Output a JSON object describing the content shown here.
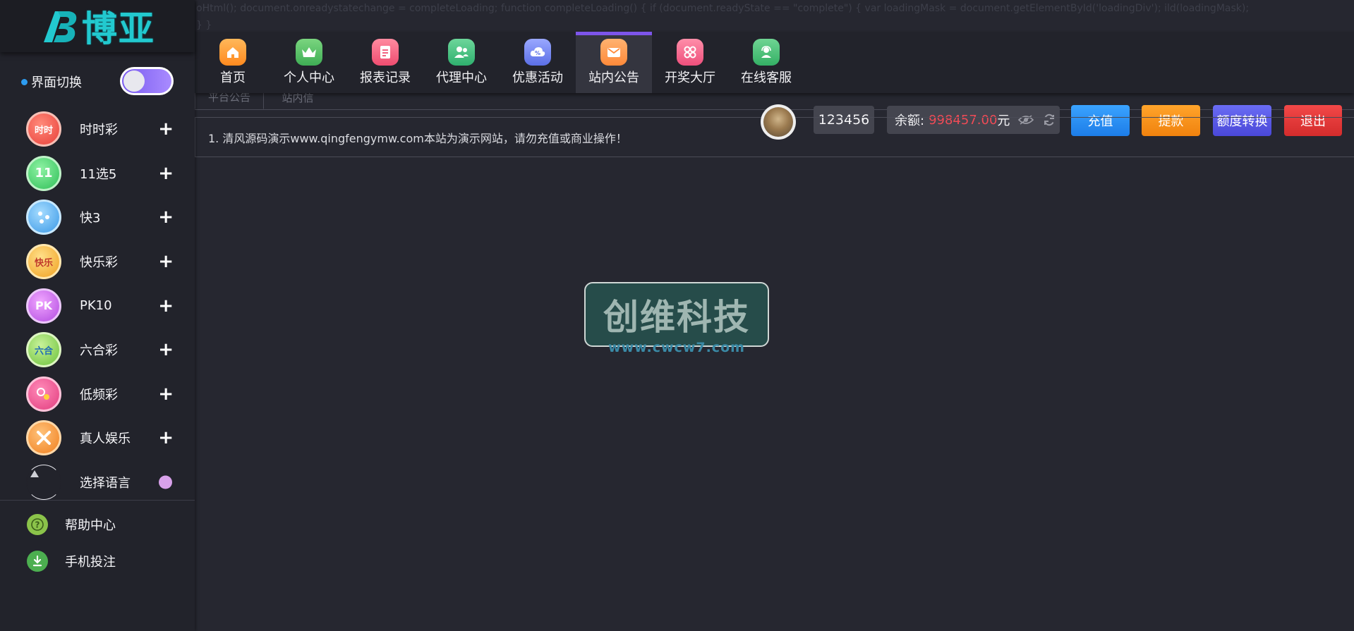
{
  "code_text": "oHtml(); document.onreadystatechange = completeLoading; function completeLoading() { if (document.readyState == \"complete\") { var loadingMask = document.getElementById('loadingDiv'); ild(loadingMask); } }",
  "logo": {
    "text": "博亚"
  },
  "theme_switch": {
    "label": "界面切换"
  },
  "sidebar": {
    "items": [
      {
        "label": "时时彩",
        "icon": "shishicai-icon",
        "badge": "时时"
      },
      {
        "label": "11选5",
        "icon": "11x5-icon",
        "badge": "11"
      },
      {
        "label": "快3",
        "icon": "dice-icon",
        "badge": ""
      },
      {
        "label": "快乐彩",
        "icon": "kuailecai-icon",
        "badge": "快乐"
      },
      {
        "label": "PK10",
        "icon": "pk10-icon",
        "badge": "PK"
      },
      {
        "label": "六合彩",
        "icon": "liuhecai-icon",
        "badge": "六合"
      },
      {
        "label": "低频彩",
        "icon": "lowfreq-icon",
        "badge": ""
      },
      {
        "label": "真人娱乐",
        "icon": "live-casino-icon",
        "badge": ""
      },
      {
        "label": "选择语言",
        "icon": "language-icon",
        "badge": ""
      }
    ],
    "bottom": [
      {
        "label": "帮助中心",
        "icon": "help-icon"
      },
      {
        "label": "手机投注",
        "icon": "download-icon"
      }
    ]
  },
  "nav": {
    "items": [
      {
        "label": "首页",
        "icon": "home-icon",
        "color": "#ffa33a"
      },
      {
        "label": "个人中心",
        "icon": "crown-icon",
        "color": "#5ec46a"
      },
      {
        "label": "报表记录",
        "icon": "report-icon",
        "color": "#f56b87"
      },
      {
        "label": "代理中心",
        "icon": "agent-icon",
        "color": "#4cc285"
      },
      {
        "label": "优惠活动",
        "icon": "promo-icon",
        "color": "#7a8cf0"
      },
      {
        "label": "站内公告",
        "icon": "mail-icon",
        "color": "#ff9a4a"
      },
      {
        "label": "开奖大厅",
        "icon": "lottery-hall-icon",
        "color": "#f06a8e"
      },
      {
        "label": "在线客服",
        "icon": "support-icon",
        "color": "#4fc27b"
      }
    ],
    "active_index": 5
  },
  "subtabs": {
    "first": "平台公告",
    "second": "站内信"
  },
  "user": {
    "id": "123456",
    "balance_label": "余额:",
    "balance_value": "998457.00",
    "balance_unit": "元"
  },
  "actions": {
    "recharge": "充值",
    "withdraw": "提款",
    "transfer": "额度转换",
    "logout": "退出"
  },
  "notice": {
    "text": "1. 清风源码演示www.qingfengymw.com本站为演示网站，请勿充值或商业操作！"
  },
  "watermark": {
    "text": "创维科技",
    "url": "www.cwcw7.com"
  }
}
